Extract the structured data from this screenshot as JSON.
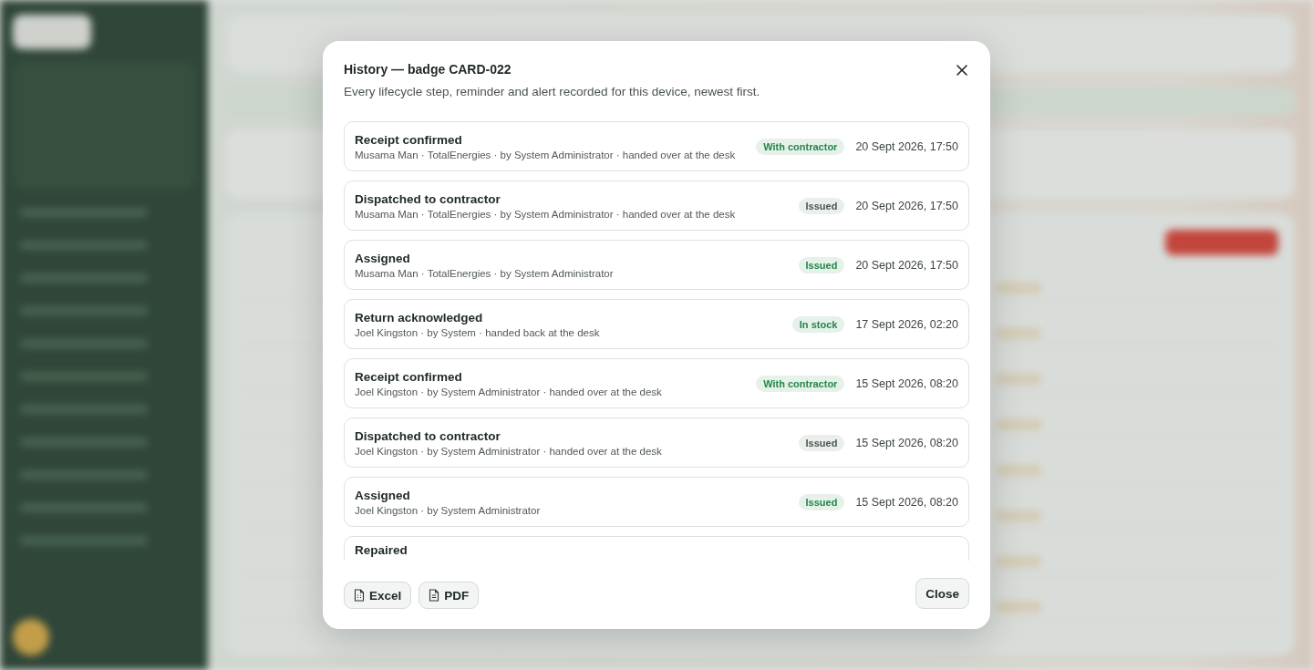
{
  "dialog": {
    "title": "History — badge CARD-022",
    "subtitle": "Every lifecycle step, reminder and alert recorded for this device, newest first.",
    "events": [
      {
        "title": "Receipt confirmed",
        "detail": "Musama Man · TotalEnergies · by System Administrator · handed over at the desk",
        "status": {
          "label": "With contractor",
          "kind": "success"
        },
        "time": "20 Sept 2026, 17:50"
      },
      {
        "title": "Dispatched to contractor",
        "detail": "Musama Man · TotalEnergies · by System Administrator · handed over at the desk",
        "status": {
          "label": "Issued",
          "kind": "neutral"
        },
        "time": "20 Sept 2026, 17:50"
      },
      {
        "title": "Assigned",
        "detail": "Musama Man · TotalEnergies · by System Administrator",
        "status": {
          "label": "Issued",
          "kind": "success"
        },
        "time": "20 Sept 2026, 17:50"
      },
      {
        "title": "Return acknowledged",
        "detail": "Joel Kingston · by System · handed back at the desk",
        "status": {
          "label": "In stock",
          "kind": "success"
        },
        "time": "17 Sept 2026, 02:20"
      },
      {
        "title": "Receipt confirmed",
        "detail": "Joel Kingston · by System Administrator · handed over at the desk",
        "status": {
          "label": "With contractor",
          "kind": "success"
        },
        "time": "15 Sept 2026, 08:20"
      },
      {
        "title": "Dispatched to contractor",
        "detail": "Joel Kingston · by System Administrator · handed over at the desk",
        "status": {
          "label": "Issued",
          "kind": "neutral"
        },
        "time": "15 Sept 2026, 08:20"
      },
      {
        "title": "Assigned",
        "detail": "Joel Kingston · by System Administrator",
        "status": {
          "label": "Issued",
          "kind": "success"
        },
        "time": "15 Sept 2026, 08:20"
      },
      {
        "title": "Repaired"
      }
    ],
    "export_buttons": [
      {
        "label": "Excel",
        "kind": "sheet"
      },
      {
        "label": "PDF",
        "kind": "doc"
      }
    ],
    "close_button": "Close"
  }
}
